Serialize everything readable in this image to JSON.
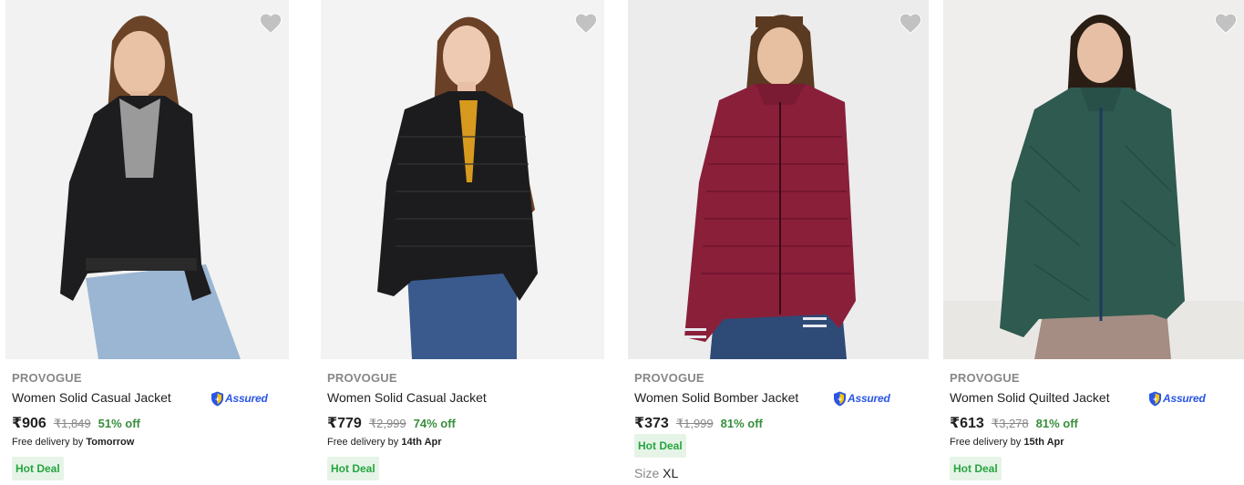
{
  "products": [
    {
      "brand": "PROVOGUE",
      "title": "Women Solid Casual Jacket",
      "assured": true,
      "assured_label": "Assured",
      "price": "₹906",
      "mrp": "₹1,849",
      "discount": "51% off",
      "delivery_prefix": "Free delivery by",
      "delivery_day": "Tomorrow",
      "badge": "Hot Deal",
      "jacket_color": "#1d1d1f",
      "inner_color": "#9a9a9a"
    },
    {
      "brand": "PROVOGUE",
      "title": "Women Solid Casual Jacket",
      "assured": false,
      "price": "₹779",
      "mrp": "₹2,999",
      "discount": "74% off",
      "delivery_prefix": "Free delivery by",
      "delivery_day": "14th Apr",
      "badge": "Hot Deal",
      "jacket_color": "#1c1c1e",
      "inner_color": "#d79a1e"
    },
    {
      "brand": "PROVOGUE",
      "title": "Women Solid Bomber Jacket",
      "assured": true,
      "assured_label": "Assured",
      "price": "₹373",
      "mrp": "₹1,999",
      "discount": "81% off",
      "badge": "Hot Deal",
      "size_label": "Size",
      "size_value": "XL",
      "jacket_color": "#8a1f3a",
      "inner_color": "#8a1f3a"
    },
    {
      "brand": "PROVOGUE",
      "title": "Women Solid Quilted Jacket",
      "assured": true,
      "assured_label": "Assured",
      "price": "₹613",
      "mrp": "₹3,278",
      "discount": "81% off",
      "delivery_prefix": "Free delivery by",
      "delivery_day": "15th Apr",
      "badge": "Hot Deal",
      "jacket_color": "#2f5a50",
      "inner_color": "#2f5a50"
    }
  ],
  "icons": {
    "wishlist": "heart-icon",
    "assured": "shield-icon"
  },
  "colors": {
    "heart": "#c2c2c2",
    "assured_blue": "#2a55e5",
    "discount_green": "#388e3c",
    "deal_bg": "#e6f4e7",
    "deal_text": "#26a541"
  }
}
